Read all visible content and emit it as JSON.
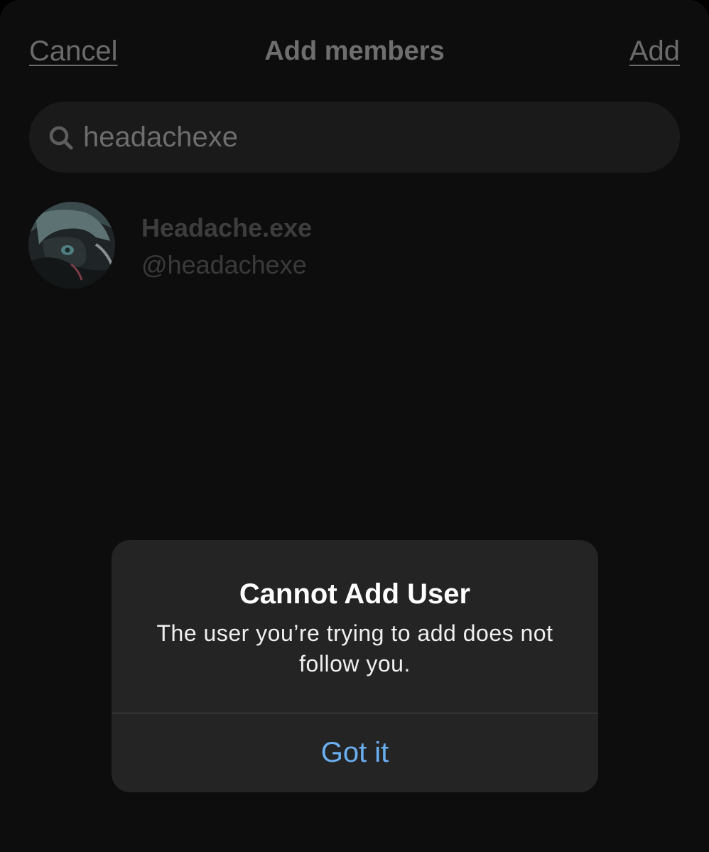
{
  "header": {
    "cancel_label": "Cancel",
    "title": "Add members",
    "add_label": "Add"
  },
  "search": {
    "icon": "search-icon",
    "value": "headachexe"
  },
  "results": [
    {
      "display_name": "Headache.exe",
      "handle": "@headachexe",
      "avatar": "avatar-image"
    }
  ],
  "alert": {
    "title": "Cannot Add User",
    "message": "The user you’re trying to add does not follow you.",
    "button_label": "Got it",
    "button_color": "#6aaff0"
  },
  "colors": {
    "background": "#0d0d0d",
    "alert_background": "#242424",
    "dimmed_text": "#6b6b6b"
  }
}
